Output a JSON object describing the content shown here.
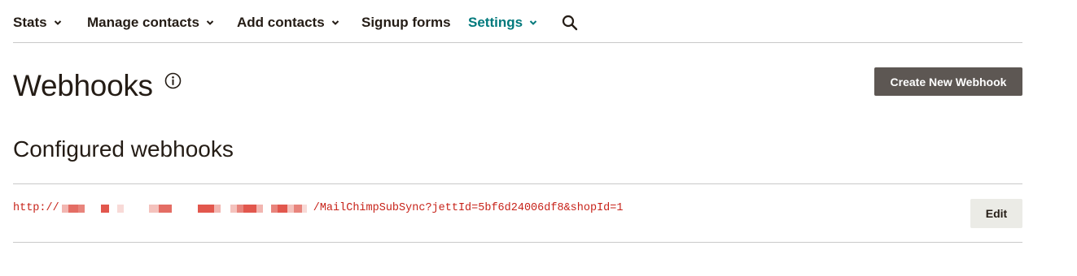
{
  "nav": {
    "items": [
      {
        "label": "Stats",
        "has_dropdown": true
      },
      {
        "label": "Manage contacts",
        "has_dropdown": true
      },
      {
        "label": "Add contacts",
        "has_dropdown": true
      },
      {
        "label": "Signup forms",
        "has_dropdown": false
      },
      {
        "label": "Settings",
        "has_dropdown": true,
        "active": true
      }
    ],
    "search_icon": "search-icon"
  },
  "page": {
    "title": "Webhooks",
    "info_icon": "info-icon",
    "create_button_label": "Create New Webhook"
  },
  "webhooks": {
    "section_title": "Configured webhooks",
    "items": [
      {
        "url_prefix": "http://",
        "url_suffix": "/MailChimpSubSync?jettId=5bf6d24006df8&shopId=1",
        "edit_label": "Edit"
      }
    ]
  },
  "colors": {
    "text": "#241c15",
    "active_nav": "#00797c",
    "primary_button": "#5d5753",
    "secondary_button": "#ebebe6",
    "url": "#c7231a",
    "divider": "#c9c9c9"
  }
}
